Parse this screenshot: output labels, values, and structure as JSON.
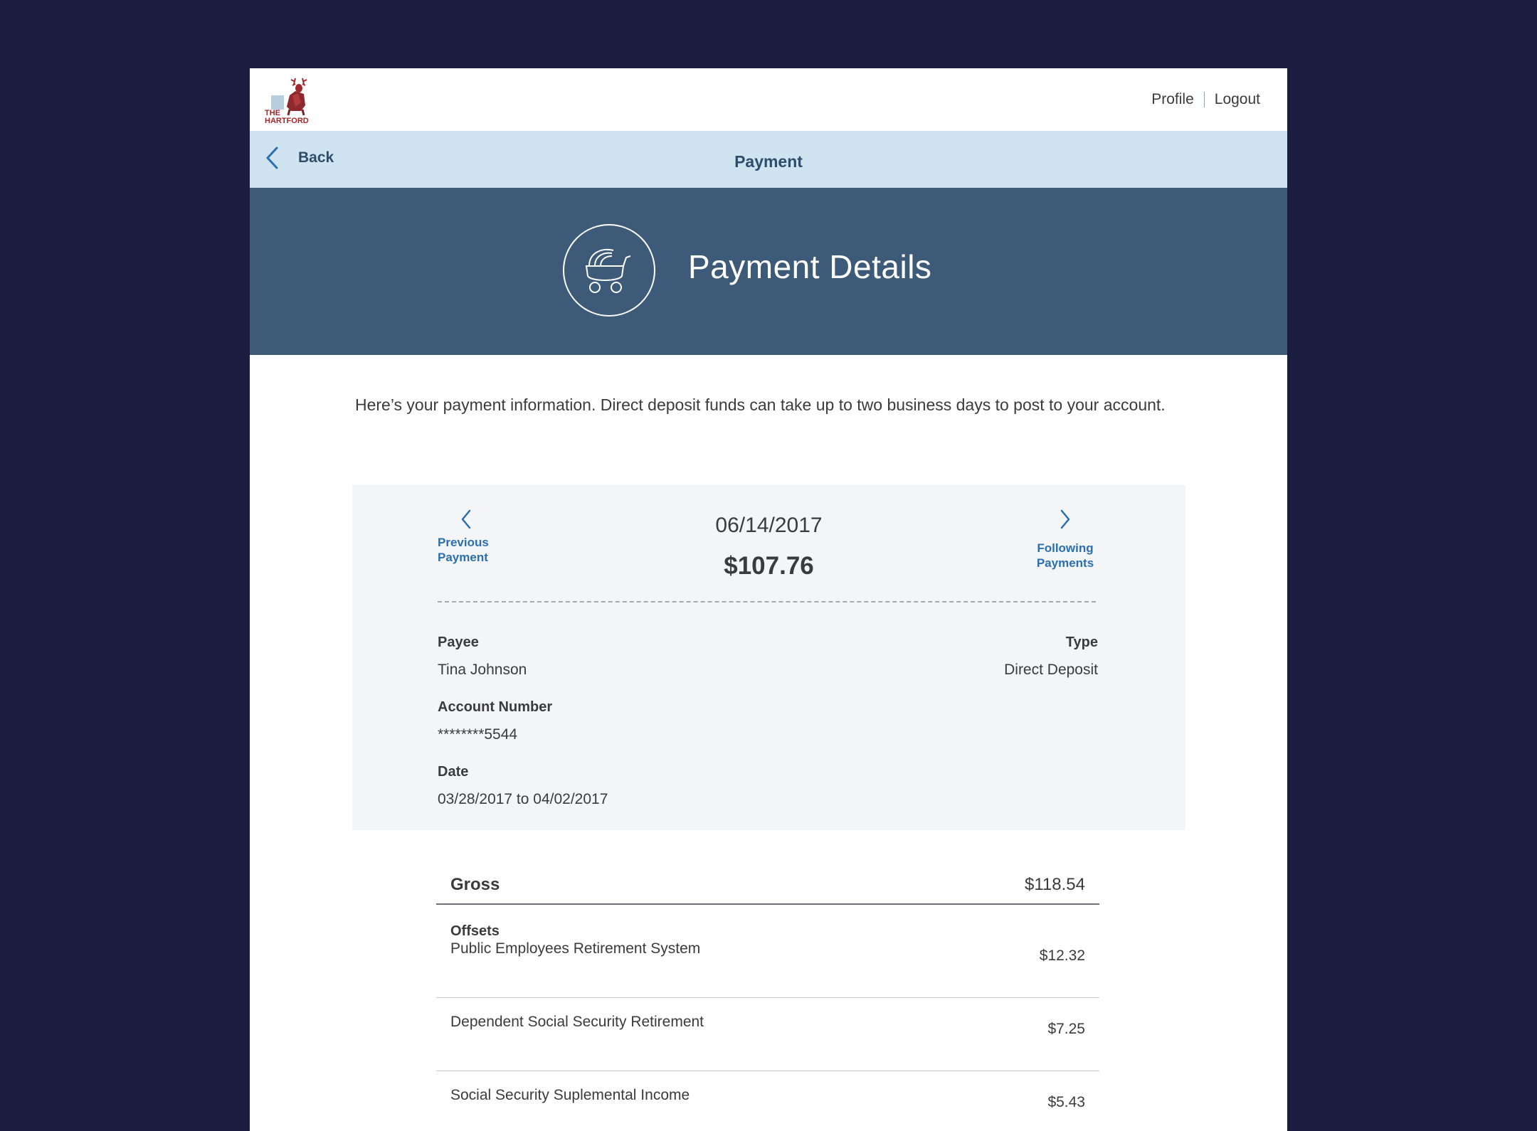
{
  "header": {
    "logo_text_line1": "THE",
    "logo_text_line2": "HARTFORD",
    "profile_label": "Profile",
    "logout_label": "Logout"
  },
  "subnav": {
    "back_label": "Back",
    "title": "Payment"
  },
  "hero": {
    "title": "Payment Details",
    "icon": "stroller-icon"
  },
  "intro_text": "Here’s your payment information. Direct deposit funds can take up to two business days to post to your account.",
  "payment": {
    "prev_label_line1": "Previous",
    "prev_label_line2": "Payment",
    "next_label_line1": "Following",
    "next_label_line2": "Payments",
    "date": "06/14/2017",
    "amount": "$107.76",
    "payee_label": "Payee",
    "payee_value": "Tina Johnson",
    "type_label": "Type",
    "type_value": "Direct Deposit",
    "account_label": "Account Number",
    "account_value": "********5544",
    "date_label": "Date",
    "date_range": "03/28/2017 to 04/02/2017"
  },
  "ledger": {
    "gross_label": "Gross",
    "gross_value": "$118.54",
    "offsets_label": "Offsets",
    "items": [
      {
        "label": "Public Employees Retirement System",
        "value": "$12.32"
      },
      {
        "label": "Dependent Social Security Retirement",
        "value": "$7.25"
      },
      {
        "label": "Social Security Suplemental Income",
        "value": "$5.43"
      }
    ]
  },
  "colors": {
    "page_bg": "#1a1d40",
    "subnav_bg": "#d0e3f1",
    "hero_bg": "#3d5b78",
    "link_blue": "#2a6fb0",
    "brand_red": "#a0262b"
  }
}
